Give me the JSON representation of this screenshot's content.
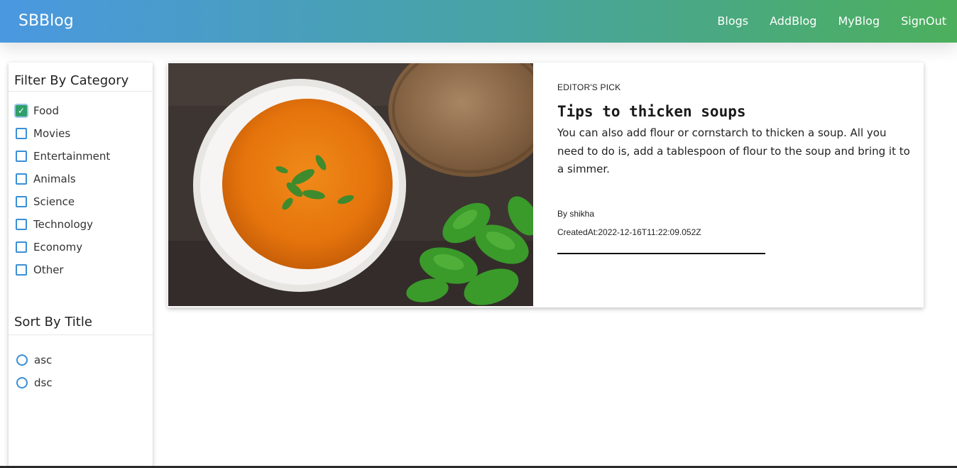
{
  "nav": {
    "brand": "SBBlog",
    "links": [
      "Blogs",
      "AddBlog",
      "MyBlog",
      "SignOut"
    ]
  },
  "sidebar": {
    "filter_title": "Filter By Category",
    "categories": [
      {
        "label": "Food",
        "checked": true
      },
      {
        "label": "Movies",
        "checked": false
      },
      {
        "label": "Entertainment",
        "checked": false
      },
      {
        "label": "Animals",
        "checked": false
      },
      {
        "label": "Science",
        "checked": false
      },
      {
        "label": "Technology",
        "checked": false
      },
      {
        "label": "Economy",
        "checked": false
      },
      {
        "label": "Other",
        "checked": false
      }
    ],
    "sort_title": "Sort By Title",
    "sort_options": [
      "asc",
      "dsc"
    ]
  },
  "card": {
    "kicker": "EDITOR'S PICK",
    "title": "Tips to thicken soups",
    "description": "You can also add flour or cornstarch to thicken a soup. All you need to do is, add a tablespoon of flour to the soup and bring it to a simmer.",
    "author": "By shikha",
    "created": "CreatedAt:2022-12-16T11:22:09.052Z",
    "image": "soup-photo"
  },
  "colors": {
    "nav_gradient_start": "#4a98e0",
    "nav_gradient_end": "#4caf5c",
    "checkbox_accent": "#3a8fd6",
    "checked_fill": "#2e9f6a"
  }
}
